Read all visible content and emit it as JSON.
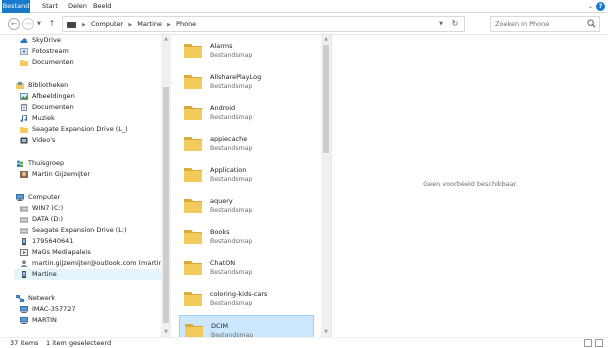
{
  "ribbon": {
    "tabs": [
      "Bestand",
      "Start",
      "Delen",
      "Beeld"
    ]
  },
  "address": {
    "crumbs": [
      "Computer",
      "Martine",
      "Phone"
    ],
    "search_placeholder": "Zoeken in Phone"
  },
  "nav": {
    "items": [
      {
        "label": "SkyDrive",
        "icon": "cloud-icon"
      },
      {
        "label": "Fotostream",
        "icon": "photostream-icon"
      },
      {
        "label": "Documenten",
        "icon": "folder-icon"
      },
      {
        "label": "Bibliotheken",
        "icon": "libraries-icon"
      },
      {
        "label": "Afbeeldingen",
        "icon": "pictures-icon"
      },
      {
        "label": "Documenten",
        "icon": "documents-icon"
      },
      {
        "label": "Muziek",
        "icon": "music-icon"
      },
      {
        "label": "Seagate Expansion Drive (L_)",
        "icon": "folder-icon"
      },
      {
        "label": "Video's",
        "icon": "videos-icon"
      },
      {
        "label": "Thuisgroep",
        "icon": "homegroup-icon"
      },
      {
        "label": "Martin Gijzemijter",
        "icon": "user-icon"
      },
      {
        "label": "Computer",
        "icon": "computer-icon"
      },
      {
        "label": "WIN7 (C:)",
        "icon": "drive-icon"
      },
      {
        "label": "DATA (D:)",
        "icon": "drive-icon"
      },
      {
        "label": "Seagate Expansion Drive (L:)",
        "icon": "drive-icon"
      },
      {
        "label": "1795640641",
        "icon": "phone-icon"
      },
      {
        "label": "MaGs Mediapaleis",
        "icon": "media-server-icon"
      },
      {
        "label": "martin.gijzemijter@outlook.com (martin)",
        "icon": "user-icon"
      },
      {
        "label": "Martine",
        "icon": "phone-icon"
      },
      {
        "label": "Netwerk",
        "icon": "network-icon"
      },
      {
        "label": "IMAC-357727",
        "icon": "computer-icon"
      },
      {
        "label": "MARTIN",
        "icon": "computer-icon"
      }
    ]
  },
  "files": {
    "type_label": "Bestandsmap",
    "items": [
      "Alarms",
      "AllsharePlayLog",
      "Android",
      "appiecache",
      "Application",
      "aquery",
      "Books",
      "ChatON",
      "coloring-kids-cars",
      "DCIM"
    ]
  },
  "preview": {
    "message": "Geen voorbeeld beschikbaar."
  },
  "status": {
    "count": "37 items",
    "selection": "1 item geselecteerd"
  },
  "colors": {
    "accent": "#1979ca",
    "folder": "#f3cb5c",
    "selection_bg": "#cce8ff"
  }
}
